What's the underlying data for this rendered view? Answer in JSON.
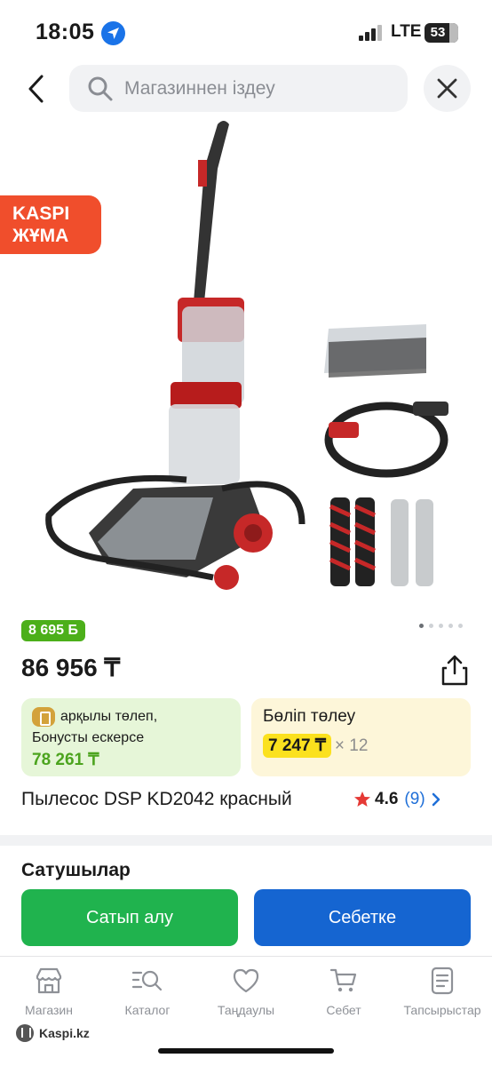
{
  "status_bar": {
    "time": "18:05",
    "network": "LTE",
    "battery": "53"
  },
  "search": {
    "placeholder": "Магазиннен іздеу"
  },
  "promo": {
    "line1": "KASPI",
    "line2": "ЖҰМА"
  },
  "product": {
    "bonus_badge": "8 695 Б",
    "price": "86 956 ₸",
    "title": "Пылесос DSP KD2042 красный",
    "rating": "4.6",
    "reviews": "(9)",
    "image_pages": 5,
    "active_page": 1
  },
  "bonus_card": {
    "line1": "арқылы төлеп,",
    "line2": "Бонусты ескерсе",
    "amount": "78 261 ₸"
  },
  "installment_card": {
    "title": "Бөліп төлеу",
    "amount": "7 247 ₸",
    "multiplier": "× 12"
  },
  "sellers": {
    "title": "Сатушылар"
  },
  "actions": {
    "buy": "Сатып алу",
    "cart": "Себетке"
  },
  "tabs": [
    {
      "label": "Магазин",
      "icon": "shop-icon"
    },
    {
      "label": "Каталог",
      "icon": "catalog-search-icon"
    },
    {
      "label": "Таңдаулы",
      "icon": "heart-icon"
    },
    {
      "label": "Себет",
      "icon": "cart-icon"
    },
    {
      "label": "Тапсырыстар",
      "icon": "orders-icon"
    }
  ],
  "footer": {
    "brand": "Kaspi.kz"
  },
  "colors": {
    "accent_blue": "#1565d1",
    "green": "#20b34e",
    "promo_red": "#f04e2c",
    "install_yellow": "#fbe11e"
  }
}
